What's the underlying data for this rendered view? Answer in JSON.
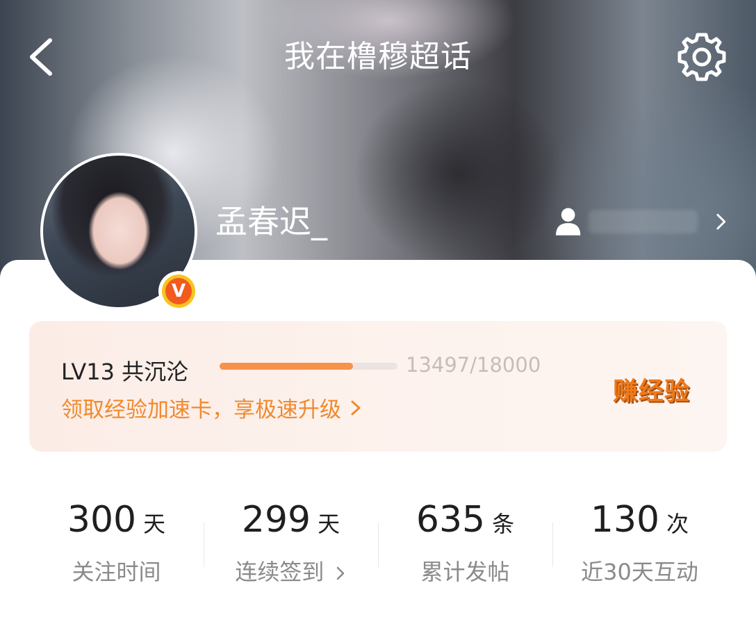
{
  "header": {
    "title": "我在橹穆超话",
    "back_icon": "chevron-left-icon",
    "settings_icon": "gear-icon"
  },
  "profile": {
    "username": "孟春迟_",
    "verified_badge": "V",
    "admin_icon": "person-icon"
  },
  "level": {
    "label": "LV13 共沉沦",
    "progress_text": "13497/18000",
    "progress_fraction": 0.7498,
    "promo_text": "领取经验加速卡，享极速升级",
    "earn_label": "赚经验"
  },
  "stats": [
    {
      "value": "300",
      "unit": "天",
      "label": "关注时间"
    },
    {
      "value": "299",
      "unit": "天",
      "label": "连续签到"
    },
    {
      "value": "635",
      "unit": "条",
      "label": "累计发帖"
    },
    {
      "value": "130",
      "unit": "次",
      "label": "近30天互动"
    }
  ],
  "colors": {
    "accent": "#f08a2e",
    "progress": "#f7924a",
    "badge_outer": "#f8c41d",
    "badge_inner": "#f25a1e"
  }
}
